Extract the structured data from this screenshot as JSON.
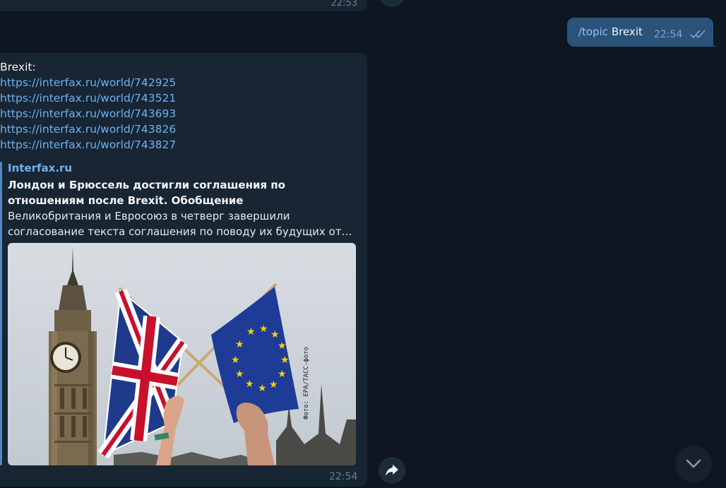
{
  "chat": {
    "previous_message": {
      "time": "22:53"
    },
    "outgoing_message": {
      "command": "/topic",
      "text": "Brexit",
      "time": "22:54",
      "status_icon": "double-check-icon"
    },
    "incoming_message": {
      "lines": [
        "Brexit:",
        "https://interfax.ru/world/742925",
        "https://interfax.ru/world/743521",
        "https://interfax.ru/world/743693",
        "https://interfax.ru/world/743826",
        "https://interfax.ru/world/743827"
      ],
      "link_preview": {
        "site": "Interfax.ru",
        "title": "Лондон и Брюссель достигли соглашения по отношениям после Brexit. Обобщение",
        "description_line1": "Великобритания и Евросоюз в четверг завершили",
        "description_line2": "согласование текста соглашения по поводу их будущих отно...",
        "image_caption": "Фото: EPA/ТАСС-фото"
      },
      "time": "22:54"
    }
  },
  "buttons": {
    "share_icon": "share-arrow-icon",
    "scroll_down_icon": "chevron-down-icon"
  },
  "colors": {
    "background": "#0e1621",
    "incoming_bubble": "#182533",
    "outgoing_bubble": "#2b5278",
    "link": "#6ab3f3"
  }
}
